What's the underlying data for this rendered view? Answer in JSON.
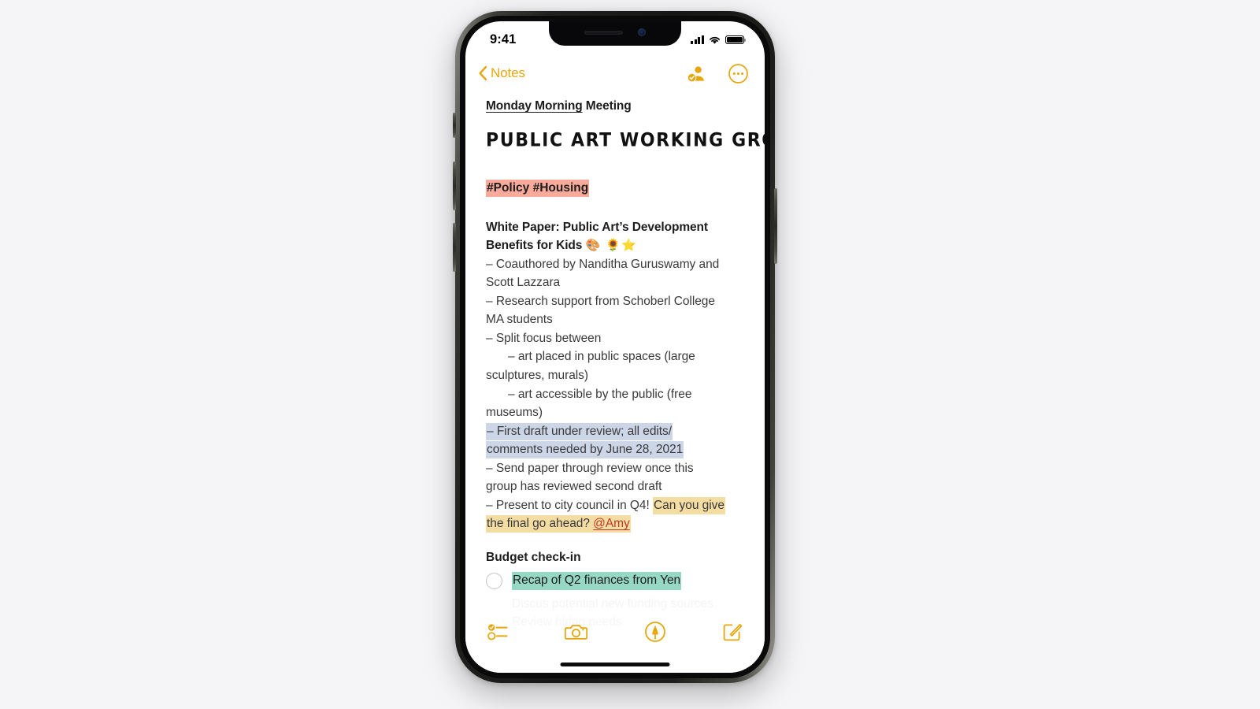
{
  "status_bar": {
    "time": "9:41",
    "signal_icon": "cellular-signal-icon",
    "wifi_icon": "wifi-icon",
    "battery_icon": "battery-icon"
  },
  "nav_bar": {
    "back_label": "Notes",
    "back_icon": "chevron-left-icon",
    "share_icon": "person-checkmark-share-icon",
    "more_icon": "more-circle-icon"
  },
  "note": {
    "doc_title_underlined": "Monday Morning",
    "doc_title_rest": " Meeting",
    "marker_heading": "PUBLIC ART WORKING GROUP",
    "tags": "#Policy #Housing",
    "white_paper_heading_line1": "White Paper: Public Art’s Development",
    "white_paper_heading_line2": "Benefits for Kids ",
    "white_paper_emoji": "🎨 🌻⭐",
    "bullets": [
      "– Coauthored by Nanditha Guruswamy and",
      "Scott Lazzara",
      "– Research support from Schoberl College",
      "MA students",
      "– Split focus between"
    ],
    "sub_bullet_1_line1": "– art placed in public spaces (large",
    "sub_bullet_1_line2": "sculptures, murals)",
    "sub_bullet_2_line1": "– art accessible by the public (free",
    "sub_bullet_2_line2": "museums)",
    "highlight_blue_line1": "– First draft under review; all edits/",
    "highlight_blue_line2": "comments needed by June 28, 2021",
    "bullets_after": [
      "– Send paper through review once this",
      "group has reviewed second draft"
    ],
    "present_line_plain": "– Present to city council in Q4! ",
    "present_line_highlight_1": "Can you give",
    "present_line_highlight_2": "the final go ahead? ",
    "mention": "@Amy",
    "budget_heading": "Budget check-in",
    "checklist_item": "Recap of Q2 finances from Yen",
    "faded_item_1": "Discus potential new funding sources",
    "faded_item_2": "Review hiring needs"
  },
  "toolbar": {
    "checklist_icon": "checklist-icon",
    "camera_icon": "camera-icon",
    "markup_icon": "markup-pen-icon",
    "compose_icon": "compose-icon"
  },
  "colors": {
    "accent": "#e6a70d",
    "highlight_pink": "#f9aa9a",
    "highlight_blue": "#ccd6e6",
    "highlight_yellow": "#f3dda2",
    "highlight_teal": "#96d8c4",
    "mention_red": "#c0392b"
  },
  "device": {
    "home_indicator": "home-indicator",
    "silent_switch": "silent-switch",
    "volume_up_button": "volume-up-button",
    "volume_down_button": "volume-down-button",
    "power_button": "power-button"
  }
}
